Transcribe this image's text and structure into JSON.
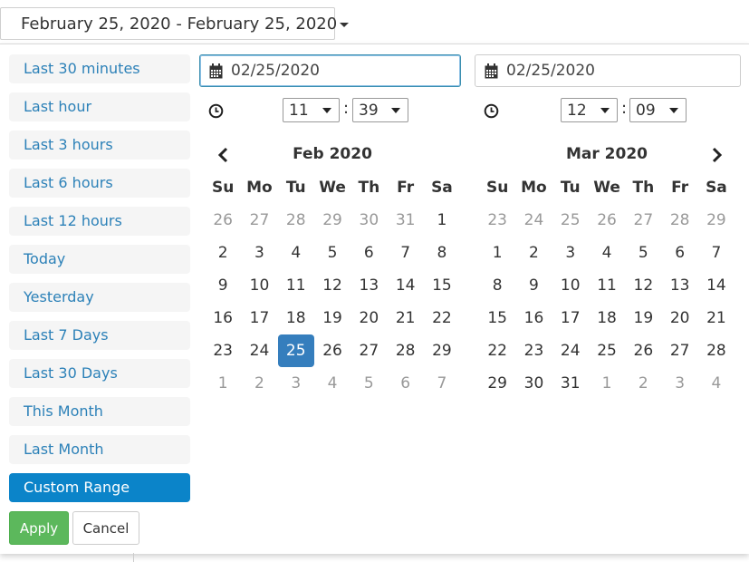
{
  "trigger": {
    "label": "February 25, 2020 - February 25, 2020"
  },
  "ranges": [
    {
      "label": "Last 30 minutes"
    },
    {
      "label": "Last hour"
    },
    {
      "label": "Last 3 hours"
    },
    {
      "label": "Last 6 hours"
    },
    {
      "label": "Last 12 hours"
    },
    {
      "label": "Today"
    },
    {
      "label": "Yesterday"
    },
    {
      "label": "Last 7 Days"
    },
    {
      "label": "Last 30 Days"
    },
    {
      "label": "This Month"
    },
    {
      "label": "Last Month"
    },
    {
      "label": "Custom Range",
      "active": true
    }
  ],
  "buttons": {
    "apply": "Apply",
    "cancel": "Cancel"
  },
  "left": {
    "date_input": "02/25/2020",
    "hour": "11",
    "minute": "39",
    "separator": ":",
    "month_label": "Feb 2020"
  },
  "right": {
    "date_input": "02/25/2020",
    "hour": "12",
    "minute": "09",
    "separator": ":",
    "month_label": "Mar 2020"
  },
  "weekdays": [
    "Su",
    "Mo",
    "Tu",
    "We",
    "Th",
    "Fr",
    "Sa"
  ],
  "calendars": [
    {
      "rows": [
        [
          "26",
          "27",
          "28",
          "29",
          "30",
          "31",
          "1"
        ],
        [
          "2",
          "3",
          "4",
          "5",
          "6",
          "7",
          "8"
        ],
        [
          "9",
          "10",
          "11",
          "12",
          "13",
          "14",
          "15"
        ],
        [
          "16",
          "17",
          "18",
          "19",
          "20",
          "21",
          "22"
        ],
        [
          "23",
          "24",
          "25",
          "26",
          "27",
          "28",
          "29"
        ],
        [
          "1",
          "2",
          "3",
          "4",
          "5",
          "6",
          "7"
        ]
      ],
      "off": [
        [
          0,
          0
        ],
        [
          0,
          1
        ],
        [
          0,
          2
        ],
        [
          0,
          3
        ],
        [
          0,
          4
        ],
        [
          0,
          5
        ],
        [
          5,
          0
        ],
        [
          5,
          1
        ],
        [
          5,
          2
        ],
        [
          5,
          3
        ],
        [
          5,
          4
        ],
        [
          5,
          5
        ],
        [
          5,
          6
        ]
      ],
      "selected": [
        4,
        2
      ]
    },
    {
      "rows": [
        [
          "23",
          "24",
          "25",
          "26",
          "27",
          "28",
          "29"
        ],
        [
          "1",
          "2",
          "3",
          "4",
          "5",
          "6",
          "7"
        ],
        [
          "8",
          "9",
          "10",
          "11",
          "12",
          "13",
          "14"
        ],
        [
          "15",
          "16",
          "17",
          "18",
          "19",
          "20",
          "21"
        ],
        [
          "22",
          "23",
          "24",
          "25",
          "26",
          "27",
          "28"
        ],
        [
          "29",
          "30",
          "31",
          "1",
          "2",
          "3",
          "4"
        ]
      ],
      "off": [
        [
          0,
          0
        ],
        [
          0,
          1
        ],
        [
          0,
          2
        ],
        [
          0,
          3
        ],
        [
          0,
          4
        ],
        [
          0,
          5
        ],
        [
          0,
          6
        ],
        [
          5,
          3
        ],
        [
          5,
          4
        ],
        [
          5,
          5
        ],
        [
          5,
          6
        ]
      ],
      "selected": null
    }
  ],
  "colors": {
    "link": "#2c81b8",
    "active": "#0b84c9",
    "apply": "#5cb85c",
    "selected_day": "#357ebd"
  }
}
